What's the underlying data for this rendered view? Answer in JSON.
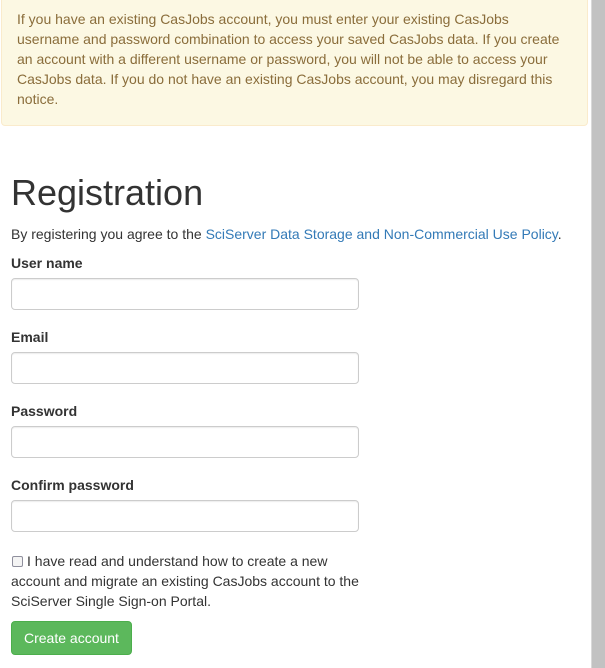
{
  "notice": {
    "text": "If you have an existing CasJobs account, you must enter your existing CasJobs username and password combination to access your saved CasJobs data. If you create an account with a different username or password, you will not be able to access your CasJobs data. If you do not have an existing CasJobs account, you may disregard this notice."
  },
  "page": {
    "title": "Registration",
    "agree_prefix": "By registering you agree to the ",
    "policy_link": "SciServer Data Storage and Non-Commercial Use Policy",
    "agree_suffix": "."
  },
  "form": {
    "username": {
      "label": "User name",
      "value": "",
      "placeholder": ""
    },
    "email": {
      "label": "Email",
      "value": "",
      "placeholder": ""
    },
    "password": {
      "label": "Password",
      "value": "",
      "placeholder": ""
    },
    "confirm_password": {
      "label": "Confirm password",
      "value": "",
      "placeholder": ""
    },
    "migrate_checkbox": {
      "checked": false,
      "label": "I have read and understand how to create a new account and migrate an existing CasJobs account to the SciServer Single Sign-on Portal."
    },
    "submit_label": "Create account"
  },
  "colors": {
    "notice_background": "#fcf8e3",
    "notice_text": "#8a6d3b",
    "link": "#337ab7",
    "submit_button": "#5cb85c"
  }
}
